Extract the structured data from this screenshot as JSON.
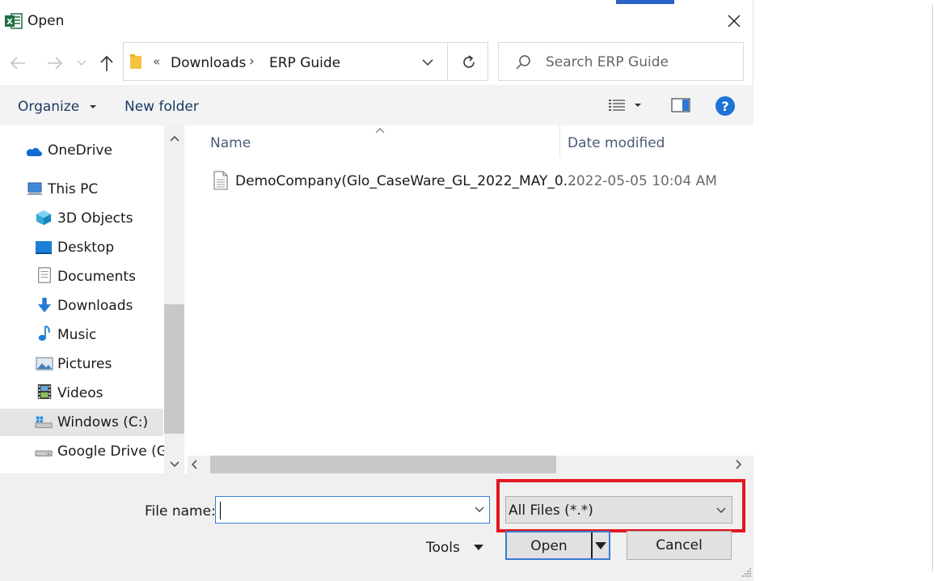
{
  "window": {
    "title": "Open"
  },
  "nav": {
    "breadcrumb_prefix": "«",
    "crumbs": [
      "Downloads",
      "ERP Guide"
    ],
    "separator": "›"
  },
  "search": {
    "placeholder": "Search ERP Guide"
  },
  "toolbar": {
    "organize_label": "Organize",
    "new_folder_label": "New folder",
    "help_label": "?"
  },
  "sidebar": {
    "items": [
      {
        "label": "OneDrive",
        "icon": "onedrive-icon"
      },
      {
        "label": "This PC",
        "icon": "computer-icon"
      },
      {
        "label": "3D Objects",
        "icon": "cube-icon"
      },
      {
        "label": "Desktop",
        "icon": "desktop-icon"
      },
      {
        "label": "Documents",
        "icon": "documents-icon"
      },
      {
        "label": "Downloads",
        "icon": "download-arrow-icon"
      },
      {
        "label": "Music",
        "icon": "music-note-icon"
      },
      {
        "label": "Pictures",
        "icon": "pictures-icon"
      },
      {
        "label": "Videos",
        "icon": "film-icon"
      },
      {
        "label": "Windows (C:)",
        "icon": "drive-c-icon",
        "selected": true
      },
      {
        "label": "Google Drive (G:",
        "icon": "drive-g-icon"
      }
    ]
  },
  "filelist": {
    "columns": [
      "Name",
      "Date modified"
    ],
    "rows": [
      {
        "name": "DemoCompany(Glo_CaseWare_GL_2022_MAY_0...",
        "date": "2022-05-05 10:04 AM"
      }
    ]
  },
  "bottom": {
    "file_name_label": "File name:",
    "file_name_value": "",
    "file_type_value": "All Files (*.*)",
    "tools_label": "Tools",
    "open_label": "Open",
    "cancel_label": "Cancel"
  },
  "colors": {
    "accent": "#1e74d6",
    "highlight": "#e3161f",
    "excel_green": "#1d6f42"
  }
}
